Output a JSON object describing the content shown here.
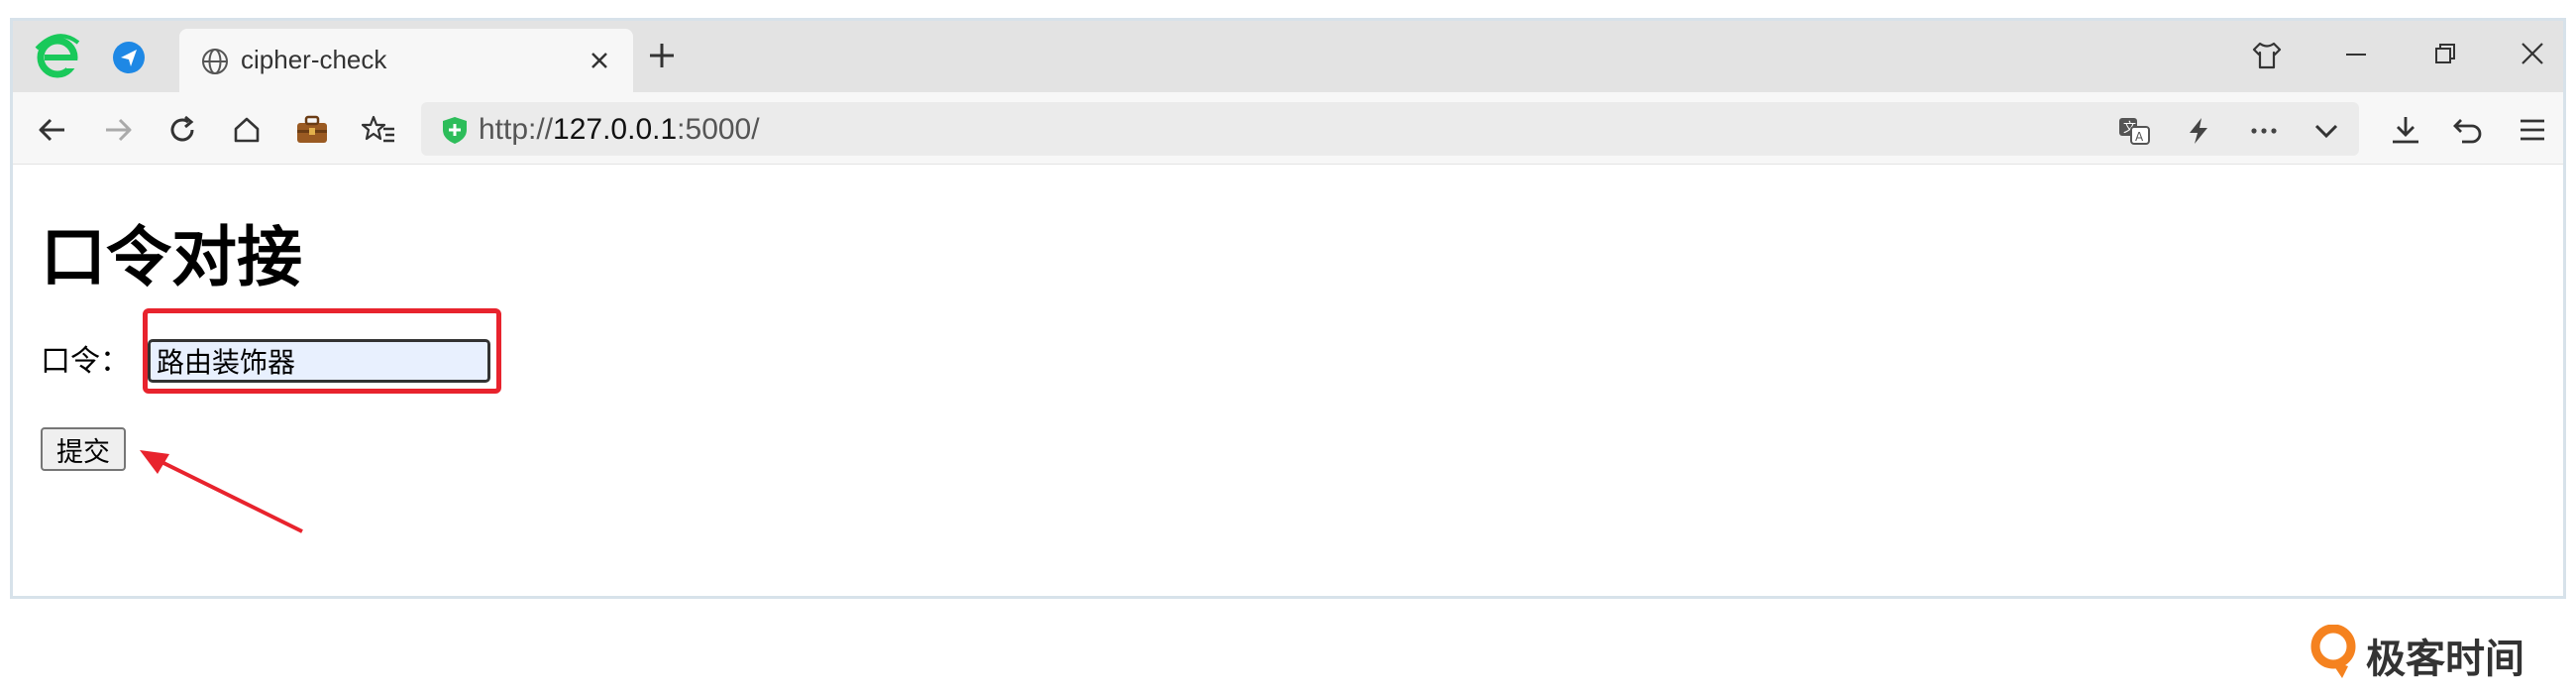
{
  "browser": {
    "tab_title": "cipher-check",
    "url_prefix": "http://",
    "url_host": "127.0.0.1",
    "url_suffix": ":5000/"
  },
  "page": {
    "heading": "口令对接",
    "cipher_label": "口令：",
    "cipher_value": "路由装饰器",
    "submit_label": "提交"
  },
  "watermark": {
    "text": "极客时间"
  },
  "colors": {
    "highlight": "#e8232d",
    "input_bg": "#e8f0fe",
    "watermark_orange": "#f5821f"
  }
}
